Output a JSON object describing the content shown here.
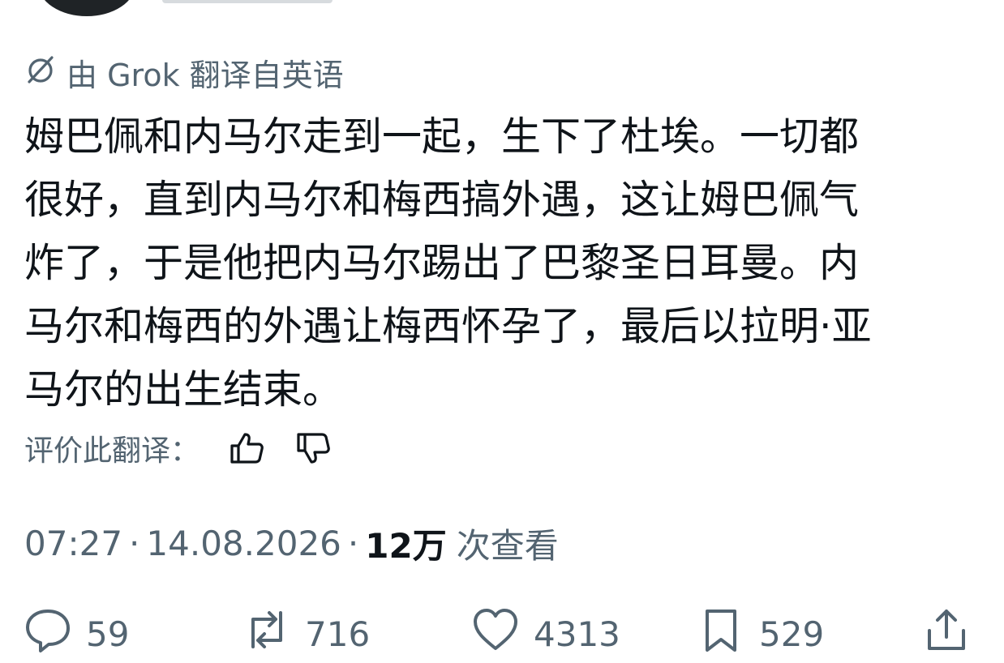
{
  "translation": {
    "label": "由 Grok 翻译自英语",
    "icon": "grok-slash-icon"
  },
  "tweet": {
    "lines": [
      "姆巴佩和内马尔走到一起，生下了杜埃。一切都",
      "很好，直到内马尔和梅西搞外遇，这让姆巴佩气",
      "炸了，于是他把内马尔踢出了巴黎圣日耳曼。内",
      "马尔和梅西的外遇让梅西怀孕了，最后以拉明·亚",
      "马尔的出生结束。"
    ]
  },
  "rate": {
    "label": "评价此翻译：",
    "icons": [
      "thumbs-up-icon",
      "thumbs-down-icon"
    ]
  },
  "meta": {
    "time": "07:27",
    "date": "14.08.2026",
    "views_count": "12万",
    "views_label": "次查看",
    "separator": "·"
  },
  "actions": {
    "replies": "59",
    "reposts": "716",
    "likes": "4313",
    "bookmarks": "529"
  },
  "colors": {
    "text": "#0f1419",
    "secondary": "#536471",
    "background": "#ffffff"
  }
}
